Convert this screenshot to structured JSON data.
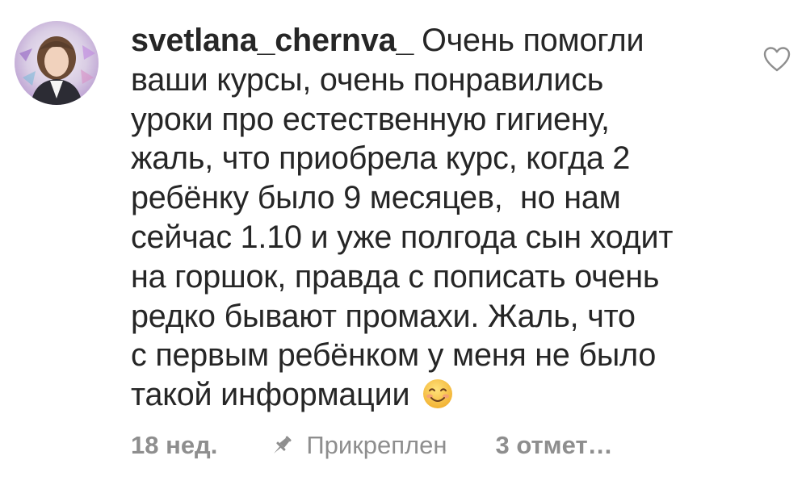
{
  "comment": {
    "username": "svetlana_chernva_",
    "text_lines": [
      "Очень помогли",
      "ваши курсы, очень понравились",
      "уроки про естественную гигиену,",
      "жаль, что приобрела курс, когда 2",
      "ребёнку было 9 месяцев,  но нам",
      "сейчас 1.10 и уже полгода сын ходит",
      "на горшок, правда с пописать очень",
      "редко бывают промахи. Жаль, что",
      "с первым ребёнком у меня не было",
      "такой информации"
    ],
    "emoji": "smiling-face-emoji",
    "avatar": "profile-avatar",
    "like_icon": "heart-outline-icon"
  },
  "meta": {
    "time": "18 нед.",
    "pin_icon": "pin-icon",
    "pinned_label": "Прикреплен",
    "likes_label": "3 отмет…"
  },
  "colors": {
    "text": "#262626",
    "secondary": "#8e8e8e",
    "emoji_face": "#f7c23e"
  }
}
